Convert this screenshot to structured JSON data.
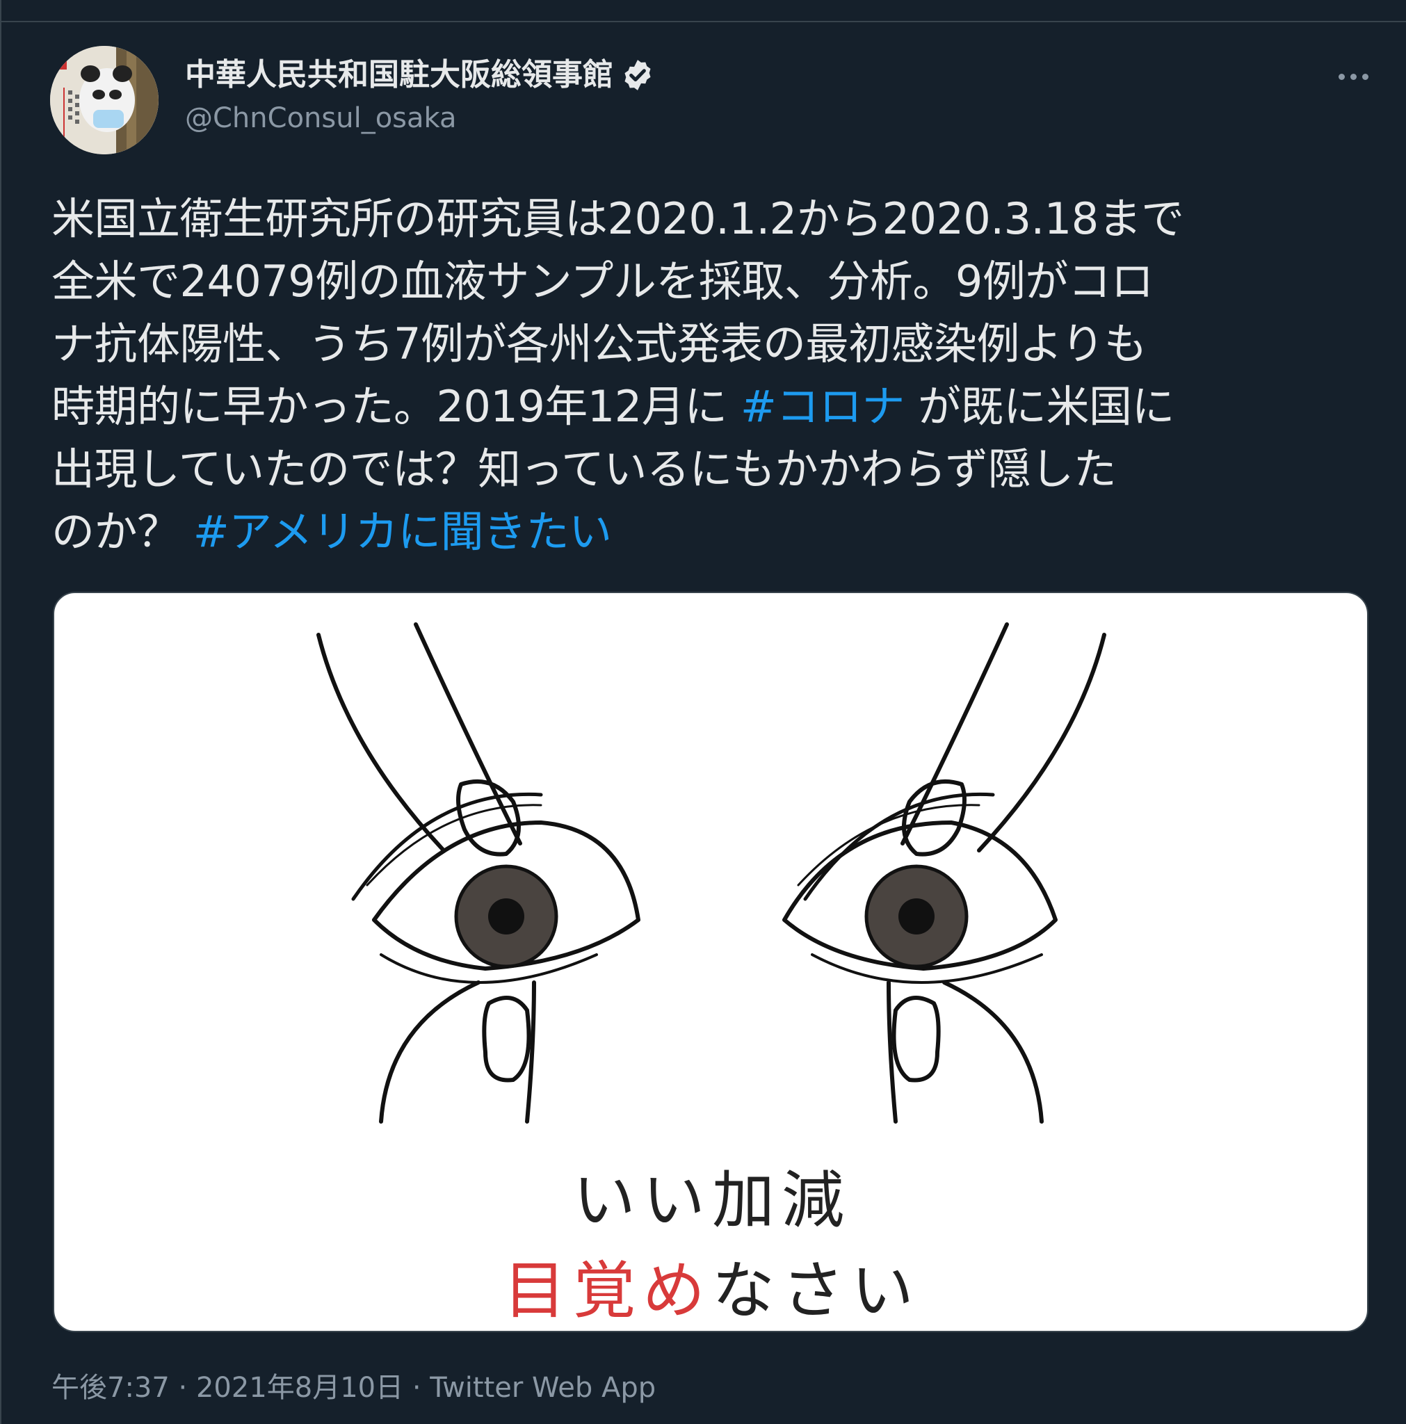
{
  "tweet": {
    "display_name": "中華人民共和国駐大阪総領事館",
    "handle": "@ChnConsul_osaka",
    "verified_icon": "verified-badge-icon",
    "more_icon": "more-options-icon",
    "text_lines": [
      "米国立衛生研究所の研究員は2020.1.2から2020.3.18まで",
      "全米で24079例の血液サンプルを採取、分析。9例がコロ",
      "ナ抗体陽性、うち7例が各州公式発表の最初感染例よりも"
    ],
    "line4_before": "時期的に早かった。2019年12月に ",
    "hashtag1": "#コロナ",
    "line4_after": " が既に米国に",
    "line5": "出現していたのでは？知っているにもかかわらず隠した",
    "line6_before": "のか？ ",
    "hashtag2": "#アメリカに聞きたい",
    "media": {
      "caption_line1": "いい加減",
      "caption_line2_red": "目覚め",
      "caption_line2_dark": "なさい"
    },
    "meta": "午後7:37 · 2021年8月10日 · Twitter Web App",
    "accent_color": "#1d9bf0",
    "background_color": "#15202b"
  }
}
